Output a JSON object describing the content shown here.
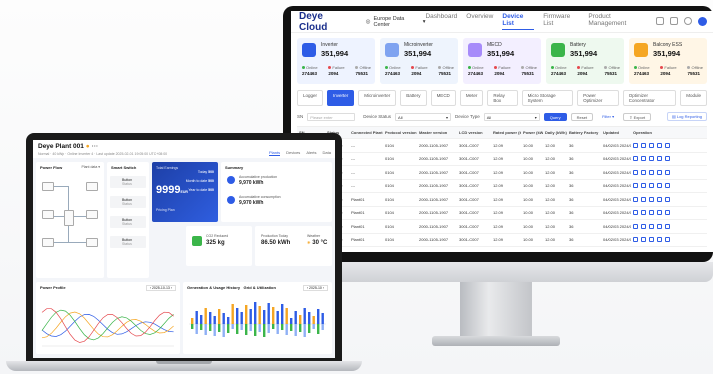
{
  "monitor": {
    "brand": "Deye Cloud",
    "location": "Europe Data Center",
    "nav": [
      "Dashboard",
      "Overview",
      "Device List",
      "Firmware List",
      "Product Management"
    ],
    "nav_active": 2,
    "cards": [
      {
        "name": "Inverter",
        "value": "351,994",
        "online": "274463",
        "failure": "2094",
        "offline": "75531",
        "color": "#2e5ce6",
        "bg": "#eef3ff"
      },
      {
        "name": "Microinverter",
        "value": "351,994",
        "online": "274463",
        "failure": "2094",
        "offline": "75531",
        "color": "#7fa3f0",
        "bg": "#eef4fd"
      },
      {
        "name": "MECD",
        "value": "351,994",
        "online": "274463",
        "failure": "2094",
        "offline": "75531",
        "color": "#a78bfa",
        "bg": "#f3efff"
      },
      {
        "name": "Battery",
        "value": "351,994",
        "online": "274463",
        "failure": "2094",
        "offline": "75531",
        "color": "#3bb54a",
        "bg": "#eef9ef"
      },
      {
        "name": "Balcony ESS",
        "value": "351,994",
        "online": "274463",
        "failure": "2094",
        "offline": "75531",
        "color": "#f5a623",
        "bg": "#fff6e6"
      }
    ],
    "labels": {
      "online": "Online",
      "failure": "Failure",
      "offline": "Offline"
    },
    "tabs": [
      "Logger",
      "Inverter",
      "Microinverter",
      "Battery",
      "MECD",
      "Meter",
      "Relay Box",
      "Micro Storage System",
      "Power Optimizer",
      "Optimizer Concentrator",
      "Module"
    ],
    "tab_active": 1,
    "filter": {
      "sn_label": "SN",
      "sn_placeholder": "Please enter",
      "status_label": "Device Status",
      "status_value": "All",
      "type_label": "Device Type",
      "type_value": "All",
      "query": "Query",
      "reset": "Reset",
      "filter": "Filter",
      "export": "Export",
      "log_reporting": "Log Reporting"
    },
    "columns": [
      "SN",
      "Status",
      "Connected Plant",
      "Protocol version",
      "Master version",
      "LCD version",
      "Rated power (kW)",
      "Power (kW)",
      "Daily (kWh)",
      "Battery Factory",
      "Updated",
      "Operation"
    ],
    "rows": [
      [
        "2202109218",
        "Online",
        "---",
        "0104",
        "2000-1105-1907",
        "3001-C007",
        "12.09",
        "10.00",
        "12.00",
        "36",
        "04/02/03 2024/09/25 UT"
      ],
      [
        "2202109218",
        "Online",
        "---",
        "0104",
        "2000-1105-1907",
        "3001-C007",
        "12.09",
        "10.00",
        "12.00",
        "36",
        "04/02/03 2024/09/25 UT"
      ],
      [
        "2202109218",
        "Online",
        "---",
        "0104",
        "2000-1105-1907",
        "3001-C007",
        "12.09",
        "10.00",
        "12.00",
        "36",
        "04/02/03 2024/09/25 UT"
      ],
      [
        "2202109218",
        "Online",
        "---",
        "0104",
        "2000-1105-1907",
        "3001-C007",
        "12.09",
        "10.00",
        "12.00",
        "36",
        "04/02/03 2024/09/25 UT"
      ],
      [
        "2202109218",
        "Online",
        "Plant01",
        "0104",
        "2000-1105-1907",
        "3001-C007",
        "12.09",
        "10.00",
        "12.00",
        "36",
        "04/02/03 2024/09/25 UT"
      ],
      [
        "2202109218",
        "Online",
        "Plant01",
        "0104",
        "2000-1105-1907",
        "3001-C007",
        "12.09",
        "10.00",
        "12.00",
        "36",
        "04/02/03 2024/09/25 UT"
      ],
      [
        "2202109218",
        "Online",
        "Plant01",
        "0104",
        "2000-1105-1907",
        "3001-C007",
        "12.09",
        "10.00",
        "12.00",
        "36",
        "04/02/03 2024/09/25 UT"
      ],
      [
        "2202109218",
        "Online",
        "Plant01",
        "0104",
        "2000-1105-1907",
        "3001-C007",
        "12.09",
        "10.00",
        "12.00",
        "36",
        "04/02/03 2024/09/25 UT"
      ]
    ],
    "pager": {
      "total": "Total 125991",
      "pages": [
        "1",
        "...",
        "4",
        "5",
        "6",
        "7",
        "8",
        "...",
        "60"
      ],
      "active": "6",
      "per_page": "10 / page"
    }
  },
  "laptop": {
    "plant_name": "Deye Plant 001",
    "status_line": "Normal · 40 kWp · Online Inverter 4 · Last update 2025-02-01 19:05:00 UTC+08:00",
    "nav": [
      "Plants",
      "Devices",
      "Alerts",
      "Data"
    ],
    "panels": {
      "flow": "Power Flow",
      "switch": "Smart Switch",
      "summary": "Summary",
      "profile": "Power Profile",
      "gen": "Generation & Usage History",
      "grid_util": "Grid & Utilization"
    },
    "plant_label": "Plant data",
    "flow_nodes": [
      "PV",
      "Grid",
      "Load",
      "Battery",
      "Gen"
    ],
    "switch_items": [
      "Button",
      "Button",
      "Button",
      "Button"
    ],
    "switch_status": "Status",
    "total_earnings_label": "Total Earnings",
    "total_earnings": "9999",
    "total_earnings_unit": "EUR",
    "today_label": "Today",
    "today_val": "500",
    "month_label": "Month to date",
    "month_val": "500",
    "year_label": "Year to date",
    "year_val": "500",
    "pricing_label": "Pricing Plan",
    "accum_prod_label": "Accumulative production",
    "accum_prod": "9,970 kWh",
    "accum_cons_label": "Accumulative consumption",
    "accum_cons": "9,970 kWh",
    "co2_label": "CO2 Reduced",
    "co2": "325 kg",
    "prod_today_label": "Production Today",
    "prod_today": "86.50 kWh",
    "weather_label": "Weather",
    "weather": "30 °C",
    "profile_date": "2025-10-13",
    "gen_date": "2025-10",
    "legend_profile": [
      "PV",
      "Load",
      "Grid",
      "Battery"
    ],
    "legend_gen": [
      "Production",
      "Import",
      "Discharge",
      "Consumption",
      "Export",
      "Charge"
    ]
  }
}
